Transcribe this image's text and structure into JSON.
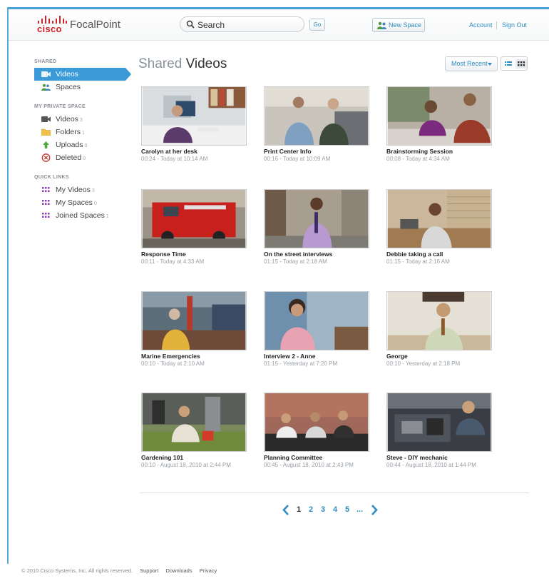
{
  "header": {
    "logo_text": "cisco",
    "app_name": "FocalPoint",
    "search_placeholder": "Search",
    "go_label": "Go",
    "new_space_label": "New Space",
    "account_label": "Account",
    "signout_label": "Sign Out"
  },
  "sidebar": {
    "shared_heading": "SHARED",
    "shared_items": [
      {
        "label": "Videos",
        "active": true
      },
      {
        "label": "Spaces"
      }
    ],
    "private_heading": "MY PRIVATE SPACE",
    "private_items": [
      {
        "label": "Videos",
        "count": "3"
      },
      {
        "label": "Folders",
        "count": "1"
      },
      {
        "label": "Uploads",
        "count": "0"
      },
      {
        "label": "Deleted",
        "count": "0"
      }
    ],
    "quick_heading": "QUICK LINKS",
    "quick_items": [
      {
        "label": "My Videos",
        "count": "3"
      },
      {
        "label": "My Spaces",
        "count": "0"
      },
      {
        "label": "Joined Spaces",
        "count": "1"
      }
    ]
  },
  "main": {
    "title_light": "Shared",
    "title_dark": "Videos",
    "sort_label": "Most Recent",
    "videos": [
      {
        "title": "Carolyn at her desk",
        "meta": "00:24 - Today at 10:14 AM"
      },
      {
        "title": "Print Center Info",
        "meta": "00:16 - Today at 10:09 AM"
      },
      {
        "title": "Brainstorming Session",
        "meta": "00:08 - Today at 4:34 AM"
      },
      {
        "title": "Response Time",
        "meta": "00:11 - Today at 4:33 AM"
      },
      {
        "title": "On the street interviews",
        "meta": "01:15 - Today at 2:18 AM"
      },
      {
        "title": "Debbie taking a call",
        "meta": "01:15 - Today at 2:16 AM"
      },
      {
        "title": "Marine Emergencies",
        "meta": "00:10 - Today at 2:10 AM"
      },
      {
        "title": "Interview 2 - Anne",
        "meta": "01:15 - Yesterday at 7:20 PM"
      },
      {
        "title": "George",
        "meta": "00:10 - Yesterday at 2:18 PM"
      },
      {
        "title": "Gardening 101",
        "meta": "00:10 - August 18, 2010 at 2:44 PM"
      },
      {
        "title": "Planning Committee",
        "meta": "00:45 - August 18, 2010 at 2:43 PM"
      },
      {
        "title": "Steve - DIY mechanic",
        "meta": "00:44 - August 18, 2010 at 1:44 PM"
      }
    ]
  },
  "pagination": {
    "pages": [
      "1",
      "2",
      "3",
      "4",
      "5"
    ],
    "ellipsis": "...",
    "current": "1"
  },
  "footer": {
    "copyright": "© 2010 Cisco Systems, Inc. All rights reserved.",
    "links": [
      "Support",
      "Downloads",
      "Privacy"
    ]
  },
  "colors": {
    "accent": "#3a9bd8",
    "link": "#2f8dc2",
    "brand": "#d0232a"
  }
}
